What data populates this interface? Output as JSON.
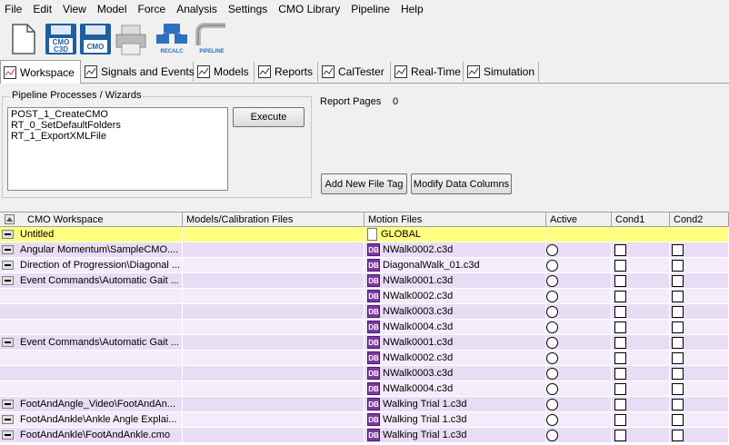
{
  "menu": [
    "File",
    "Edit",
    "View",
    "Model",
    "Force",
    "Analysis",
    "Settings",
    "CMO Library",
    "Pipeline",
    "Help"
  ],
  "toolbar": {
    "buttons": [
      {
        "name": "new-file-icon"
      },
      {
        "name": "save-cmo-c3d-icon",
        "text": "CMO C3D"
      },
      {
        "name": "save-cmo-icon",
        "text": "CMO"
      },
      {
        "name": "print-icon"
      },
      {
        "name": "recalc-icon",
        "text": "RECALC"
      },
      {
        "name": "pipeline-icon",
        "text": "PIPELINE"
      }
    ]
  },
  "tabs": [
    {
      "label": "Workspace",
      "icon": "workspace-icon",
      "active": true
    },
    {
      "label": "Signals and Events",
      "icon": "signals-icon"
    },
    {
      "label": "Models",
      "icon": "models-icon"
    },
    {
      "label": "Reports",
      "icon": "reports-icon"
    },
    {
      "label": "CalTester",
      "icon": "caltester-icon"
    },
    {
      "label": "Real-Time",
      "icon": "realtime-icon"
    },
    {
      "label": "Simulation",
      "icon": "simulation-icon"
    }
  ],
  "pipeline": {
    "title": "Pipeline Processes / Wizards",
    "items": [
      "POST_1_CreateCMO",
      "RT_0_SetDefaultFolders",
      "RT_1_ExportXMLFile"
    ],
    "execute_label": "Execute"
  },
  "report": {
    "label": "Report Pages",
    "value": "0"
  },
  "buttons": {
    "add_tag": "Add New File Tag",
    "modify_columns": "Modify Data Columns"
  },
  "grid": {
    "columns": [
      "CMO Workspace",
      "Models/Calibration Files",
      "Motion Files",
      "Active",
      "Cond1",
      "Cond2"
    ],
    "rows": [
      {
        "workspace": "Untitled",
        "motion": "GLOBAL",
        "icon": "doc",
        "minus": true,
        "highlight": true
      },
      {
        "workspace": "Angular Momentum\\SampleCMO....",
        "motion": "NWalk0002.c3d",
        "icon": "db",
        "minus": true
      },
      {
        "workspace": "Direction of Progression\\Diagonal ...",
        "motion": "DiagonalWalk_01.c3d",
        "icon": "db",
        "minus": true
      },
      {
        "workspace": "Event Commands\\Automatic Gait ...",
        "motion": "NWalk0001.c3d",
        "icon": "db",
        "minus": true
      },
      {
        "workspace": "",
        "motion": "NWalk0002.c3d",
        "icon": "db",
        "minus": false
      },
      {
        "workspace": "",
        "motion": "NWalk0003.c3d",
        "icon": "db",
        "minus": false
      },
      {
        "workspace": "",
        "motion": "NWalk0004.c3d",
        "icon": "db",
        "minus": false
      },
      {
        "workspace": "Event Commands\\Automatic Gait ...",
        "motion": "NWalk0001.c3d",
        "icon": "db",
        "minus": true
      },
      {
        "workspace": "",
        "motion": "NWalk0002.c3d",
        "icon": "db",
        "minus": false
      },
      {
        "workspace": "",
        "motion": "NWalk0003.c3d",
        "icon": "db",
        "minus": false
      },
      {
        "workspace": "",
        "motion": "NWalk0004.c3d",
        "icon": "db",
        "minus": false
      },
      {
        "workspace": "FootAndAngle_Video\\FootAndAn...",
        "motion": "Walking Trial 1.c3d",
        "icon": "db",
        "minus": true
      },
      {
        "workspace": "FootAndAnkle\\Ankle Angle Explai...",
        "motion": "Walking Trial 1.c3d",
        "icon": "db",
        "minus": true
      },
      {
        "workspace": "FootAndAnkle\\FootAndAnkle.cmo",
        "motion": "Walking Trial 1.c3d",
        "icon": "db",
        "minus": true
      }
    ]
  },
  "colors": {
    "row_highlight": "#ffff80",
    "row_even": "#e8ddf5",
    "row_odd": "#f3edfb"
  }
}
